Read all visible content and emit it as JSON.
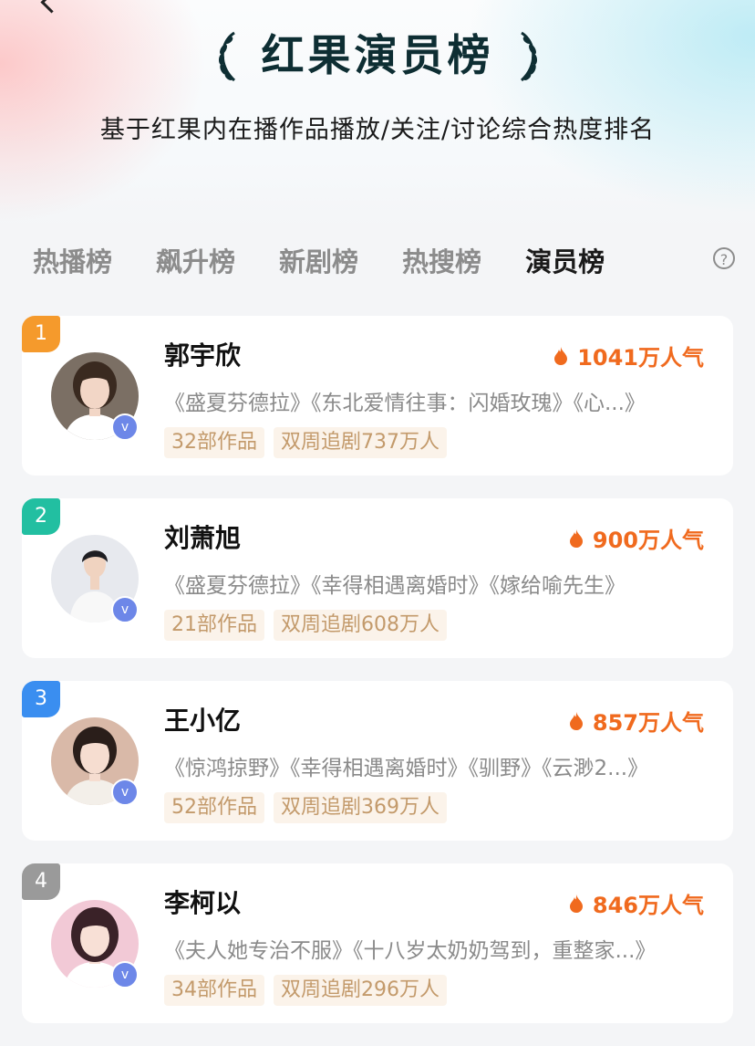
{
  "header": {
    "title": "红果演员榜",
    "subtitle": "基于红果内在播作品播放/关注/讨论综合热度排名"
  },
  "tabs": [
    {
      "label": "热播榜",
      "active": false
    },
    {
      "label": "飙升榜",
      "active": false
    },
    {
      "label": "新剧榜",
      "active": false
    },
    {
      "label": "热搜榜",
      "active": false
    },
    {
      "label": "演员榜",
      "active": true
    }
  ],
  "help_icon": "question-circle-icon",
  "help_glyph": "?",
  "verified_glyph": "v",
  "actors": [
    {
      "rank": "1",
      "rank_color": "#f59a2c",
      "name": "郭宇欣",
      "heat": "1041万人气",
      "works": "《盛夏芬德拉》《东北爱情往事：闪婚玫瑰》《心...》",
      "work_count": "32部作品",
      "followers": "双周追剧737万人",
      "avatar": {
        "bg": "#7b6f64",
        "skin": "#f2d6c6",
        "hair": "#3a2a20",
        "shirt": "#ffffff"
      }
    },
    {
      "rank": "2",
      "rank_color": "#22bfa1",
      "name": "刘萧旭",
      "heat": "900万人气",
      "works": "《盛夏芬德拉》《幸得相遇离婚时》《嫁给喻先生》",
      "work_count": "21部作品",
      "followers": "双周追剧608万人",
      "avatar": {
        "bg": "#e7e9ee",
        "skin": "#f0d3c0",
        "hair": "#1e1e22",
        "shirt": "#f8f8f8"
      }
    },
    {
      "rank": "3",
      "rank_color": "#3a8ef0",
      "name": "王小亿",
      "heat": "857万人气",
      "works": "《惊鸿掠野》《幸得相遇离婚时》《驯野》《云渺2...》",
      "work_count": "52部作品",
      "followers": "双周追剧369万人",
      "avatar": {
        "bg": "#d9b9a8",
        "skin": "#f6ddd0",
        "hair": "#2a1e1a",
        "shirt": "#f3efe9"
      }
    },
    {
      "rank": "4",
      "rank_color": "#9a9a9a",
      "name": "李柯以",
      "heat": "846万人气",
      "works": "《夫人她专治不服》《十八岁太奶奶驾到，重整家...》",
      "work_count": "34部作品",
      "followers": "双周追剧296万人",
      "avatar": {
        "bg": "#f2c9d6",
        "skin": "#f8e0d6",
        "hair": "#3a2228",
        "shirt": "#ffffff"
      }
    }
  ],
  "colors": {
    "heat": "#f06a1e",
    "tag_text": "#c39a6b",
    "tag_bg": "#fbf3ea",
    "verified": "#6d87e8"
  }
}
